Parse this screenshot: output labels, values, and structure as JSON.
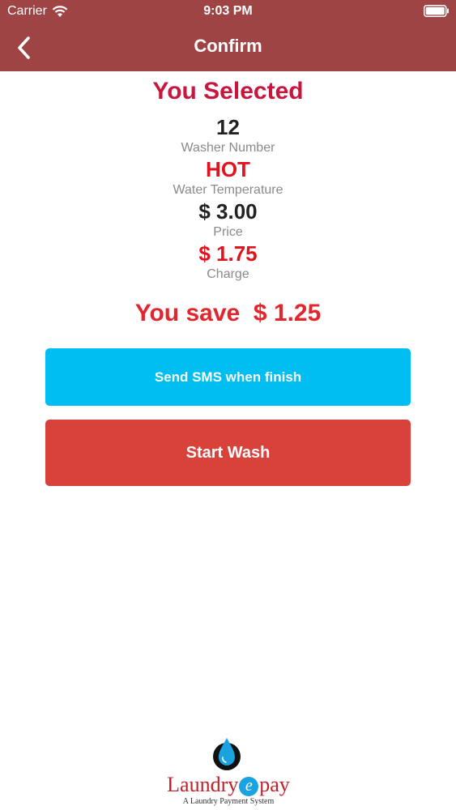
{
  "status_bar": {
    "carrier": "Carrier",
    "time": "9:03 PM"
  },
  "nav": {
    "title": "Confirm"
  },
  "selection": {
    "heading": "You Selected",
    "washer_number": "12",
    "washer_number_label": "Washer Number",
    "water_temperature": "HOT",
    "water_temperature_label": "Water Temperature",
    "price": "$ 3.00",
    "price_label": "Price",
    "charge": "$ 1.75",
    "charge_label": "Charge",
    "savings": "You save  $ 1.25"
  },
  "actions": {
    "sms_label": "Send SMS when finish",
    "start_label": "Start Wash"
  },
  "branding": {
    "logo_text_a": "Laundry",
    "logo_text_b": "pay",
    "logo_text_e": "e",
    "tagline": "A Laundry Payment System"
  },
  "colors": {
    "header": "#9e4444",
    "heading": "#c8173f",
    "accent_red": "#e0141e",
    "sms_button": "#00bdf2",
    "start_button": "#d9413b"
  }
}
